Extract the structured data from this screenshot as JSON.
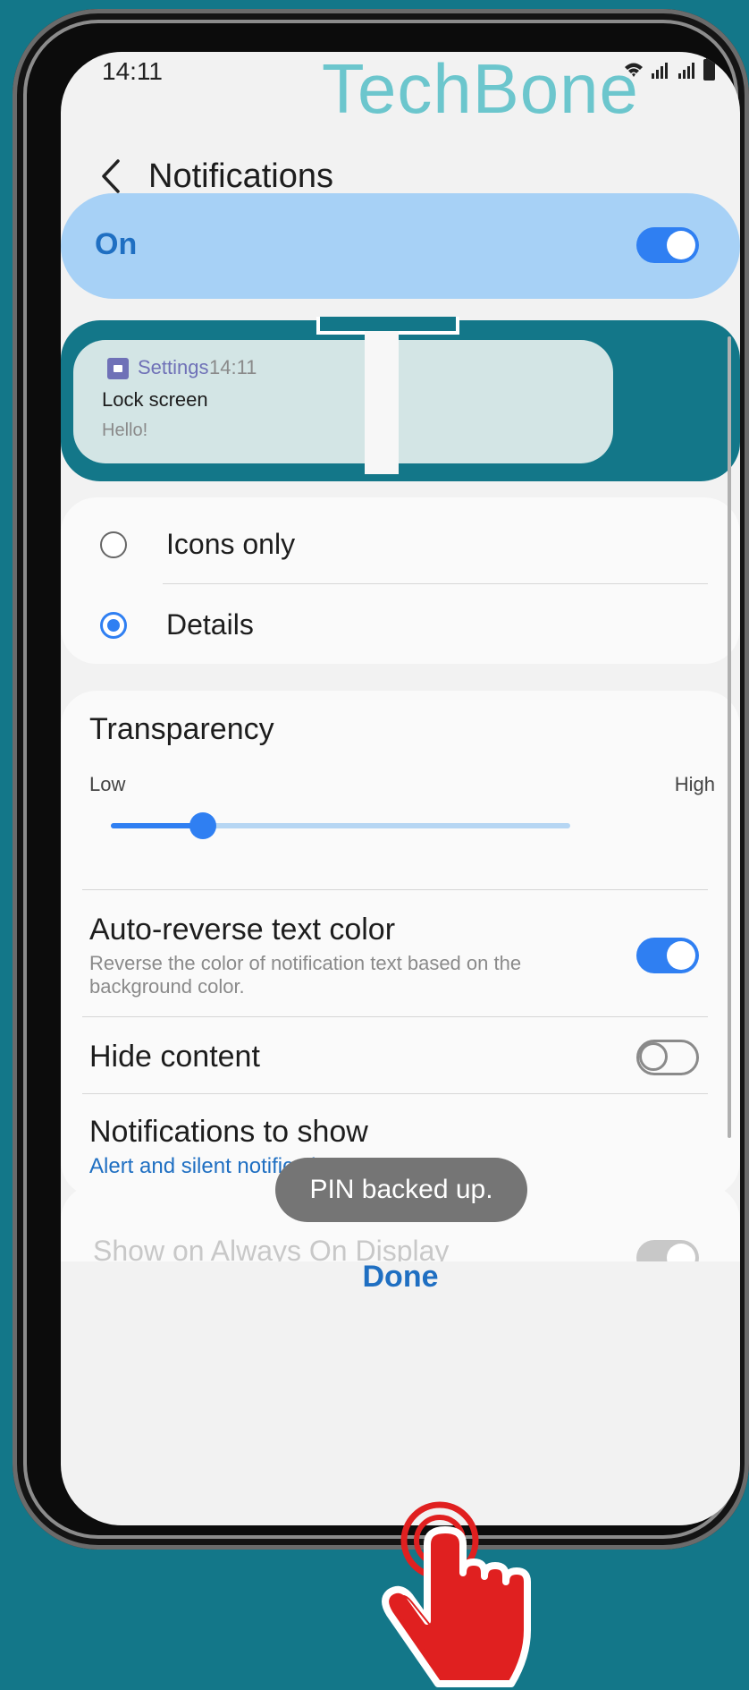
{
  "status_bar": {
    "time": "14:11"
  },
  "watermark": "TechBone",
  "header": {
    "title": "Notifications"
  },
  "master_toggle": {
    "label": "On",
    "state": "on"
  },
  "preview": {
    "app": "Settings",
    "time": "14:11",
    "title": "Lock screen",
    "text": "Hello!"
  },
  "style_options": [
    {
      "label": "Icons only",
      "selected": false
    },
    {
      "label": "Details",
      "selected": true
    }
  ],
  "transparency": {
    "title": "Transparency",
    "low": "Low",
    "high": "High",
    "value_fraction": 0.2
  },
  "auto_reverse": {
    "title": "Auto-reverse text color",
    "description": "Reverse the color of notification text based on the background color.",
    "state": "on"
  },
  "hide_content": {
    "title": "Hide content",
    "state": "off"
  },
  "notifications_to_show": {
    "title": "Notifications to show",
    "value": "Alert and silent notifications"
  },
  "partial_item": {
    "title": "Show on Always On Display"
  },
  "toast": "PIN backed up.",
  "done_label": "Done",
  "colors": {
    "accent": "#2f7ff2",
    "background": "#137789",
    "highlight": "#a7d1f6"
  }
}
